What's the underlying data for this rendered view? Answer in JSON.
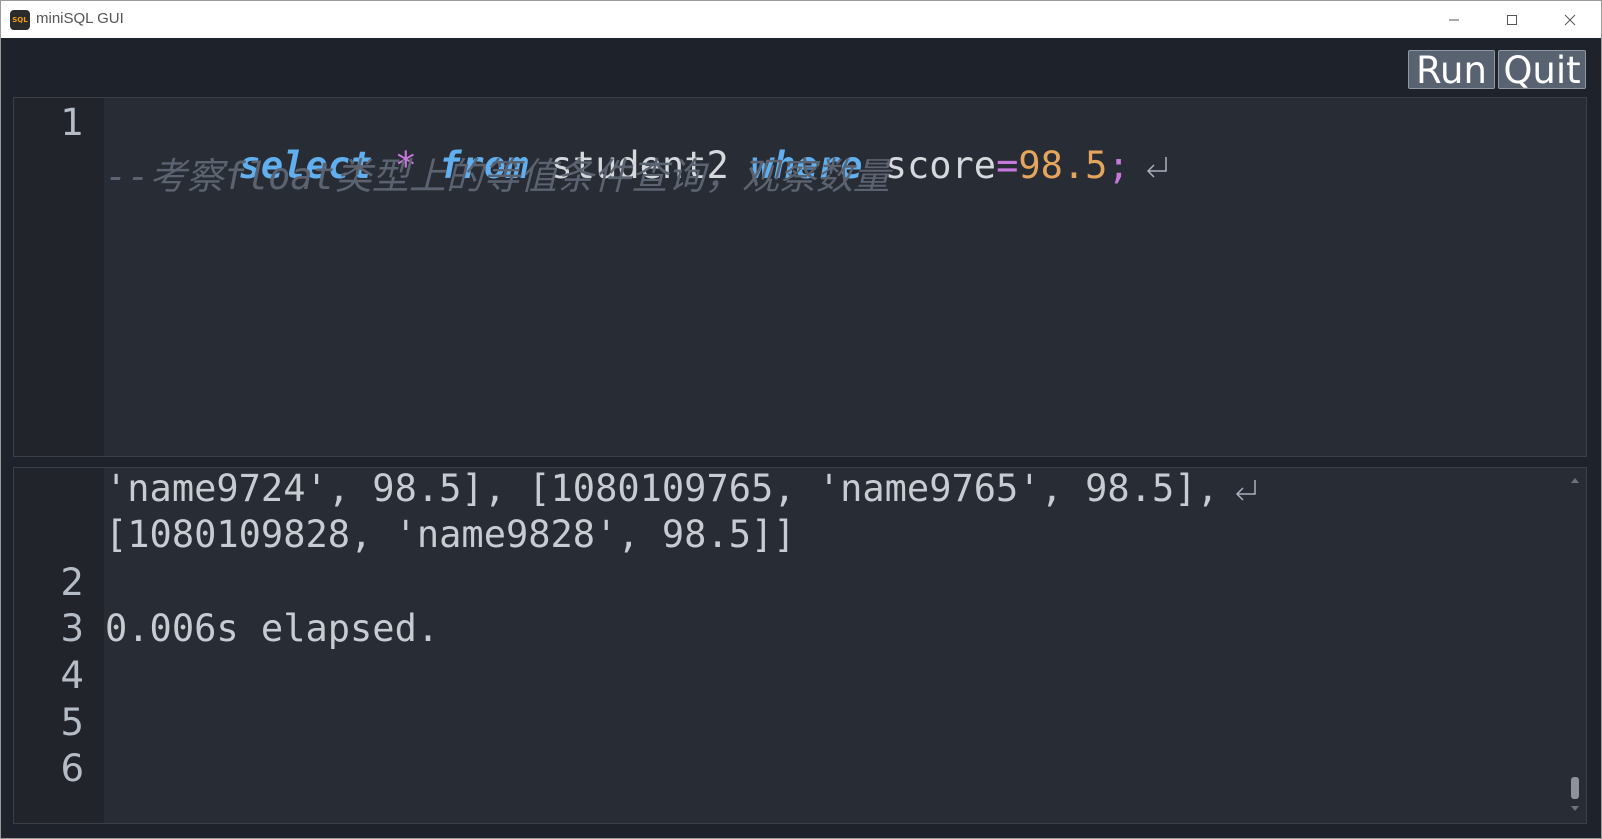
{
  "window": {
    "title": "miniSQL GUI",
    "icon_label": "SQL",
    "controls": [
      "minimize",
      "maximize",
      "close"
    ]
  },
  "toolbar": {
    "run_label": "Run",
    "quit_label": "Quit"
  },
  "editor": {
    "line_numbers": [
      "1"
    ],
    "lines": [
      {
        "tokens": [
          {
            "text": "select",
            "kind": "keyword"
          },
          {
            "text": " ",
            "kind": "space"
          },
          {
            "text": "*",
            "kind": "operator"
          },
          {
            "text": " ",
            "kind": "space"
          },
          {
            "text": "from",
            "kind": "keyword"
          },
          {
            "text": " student2 ",
            "kind": "identifier"
          },
          {
            "text": "where",
            "kind": "keyword"
          },
          {
            "text": " score",
            "kind": "identifier"
          },
          {
            "text": "=",
            "kind": "operator"
          },
          {
            "text": "98.5",
            "kind": "number"
          },
          {
            "text": ";",
            "kind": "punct"
          }
        ],
        "wrapped": true
      },
      {
        "text": "--考察float类型上的等值条件查询，观察数量",
        "kind": "comment"
      }
    ]
  },
  "output": {
    "line_numbers": [
      "2",
      "3",
      "4",
      "5",
      "6"
    ],
    "lines": [
      "'name9724', 98.5], [1080109765, 'name9765', 98.5],",
      "[1080109828, 'name9828', 98.5]]",
      "",
      "0.006s elapsed.",
      "",
      "",
      ""
    ]
  },
  "colors": {
    "keyword": "#61afef",
    "operator": "#c678dd",
    "number": "#e5a55c",
    "comment": "#5c6370",
    "text": "#d5d9de",
    "background": "#282c34",
    "gutter": "#21252b"
  }
}
